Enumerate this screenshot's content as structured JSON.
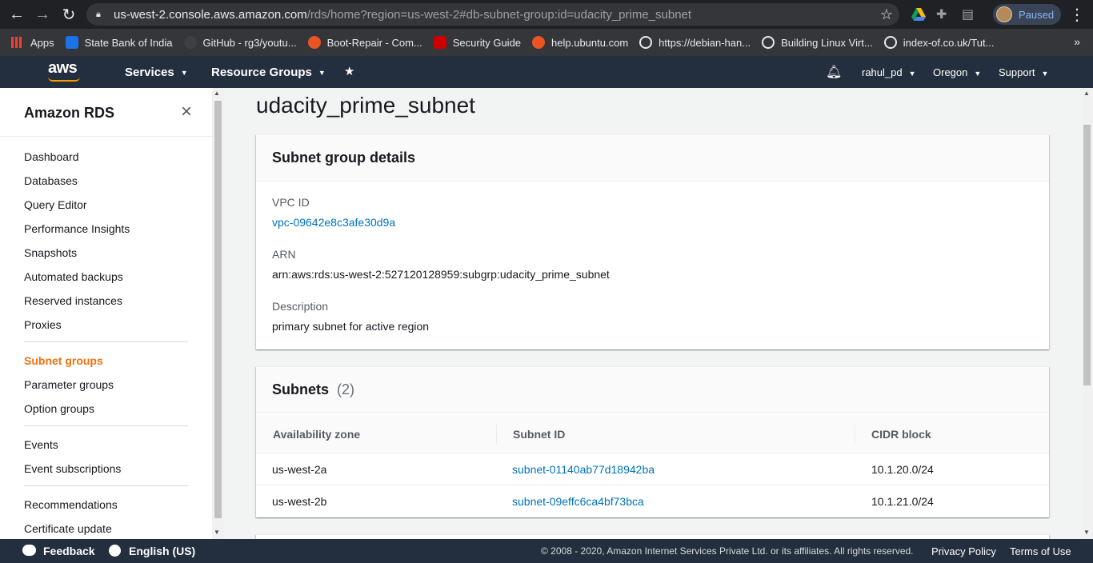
{
  "browser": {
    "url_host": "us-west-2.console.aws.amazon.com",
    "url_path": "/rds/home?region=us-west-2#db-subnet-group:id=udacity_prime_subnet",
    "profile_status": "Paused",
    "bookmarks": [
      {
        "label": "Apps",
        "color": "#ea4335"
      },
      {
        "label": "State Bank of India",
        "color": "#1a73e8"
      },
      {
        "label": "GitHub - rg3/youtu...",
        "color": "#3c4043"
      },
      {
        "label": "Boot-Repair - Com...",
        "color": "#e95420"
      },
      {
        "label": "Security Guide",
        "color": "#cc0000"
      },
      {
        "label": "help.ubuntu.com",
        "color": "#e95420"
      },
      {
        "label": "https://debian-han...",
        "color": "#9aa0a6"
      },
      {
        "label": "Building Linux Virt...",
        "color": "#9aa0a6"
      },
      {
        "label": "index-of.co.uk/Tut...",
        "color": "#9aa0a6"
      }
    ],
    "bookmarks_more": "»"
  },
  "aws_nav": {
    "logo": "aws",
    "services": "Services",
    "resource_groups": "Resource Groups",
    "user": "rahul_pd",
    "region": "Oregon",
    "support": "Support"
  },
  "sidebar": {
    "title": "Amazon RDS",
    "close": "×",
    "group1": [
      "Dashboard",
      "Databases",
      "Query Editor",
      "Performance Insights",
      "Snapshots",
      "Automated backups",
      "Reserved instances",
      "Proxies"
    ],
    "group2": [
      "Subnet groups",
      "Parameter groups",
      "Option groups"
    ],
    "group3": [
      "Events",
      "Event subscriptions"
    ],
    "group4": [
      "Recommendations",
      "Certificate update"
    ],
    "active": "Subnet groups"
  },
  "main": {
    "title": "udacity_prime_subnet",
    "details": {
      "header": "Subnet group details",
      "vpc_label": "VPC ID",
      "vpc_value": "vpc-09642e8c3afe30d9a",
      "arn_label": "ARN",
      "arn_value": "arn:aws:rds:us-west-2:527120128959:subgrp:udacity_prime_subnet",
      "desc_label": "Description",
      "desc_value": "primary subnet for active region"
    },
    "subnets": {
      "header": "Subnets",
      "count": "(2)",
      "columns": [
        "Availability zone",
        "Subnet ID",
        "CIDR block"
      ],
      "rows": [
        {
          "az": "us-west-2a",
          "subnet_id": "subnet-01140ab77d18942ba",
          "cidr": "10.1.20.0/24"
        },
        {
          "az": "us-west-2b",
          "subnet_id": "subnet-09effc6ca4bf73bca",
          "cidr": "10.1.21.0/24"
        }
      ]
    }
  },
  "footer": {
    "feedback": "Feedback",
    "language": "English (US)",
    "copyright": "© 2008 - 2020, Amazon Internet Services Private Ltd. or its affiliates. All rights reserved.",
    "privacy": "Privacy Policy",
    "terms": "Terms of Use"
  },
  "colors": {
    "aws_nav_bg": "#232f3e",
    "aws_orange": "#ff9900",
    "active_nav": "#ec7211",
    "link": "#0073bb"
  }
}
